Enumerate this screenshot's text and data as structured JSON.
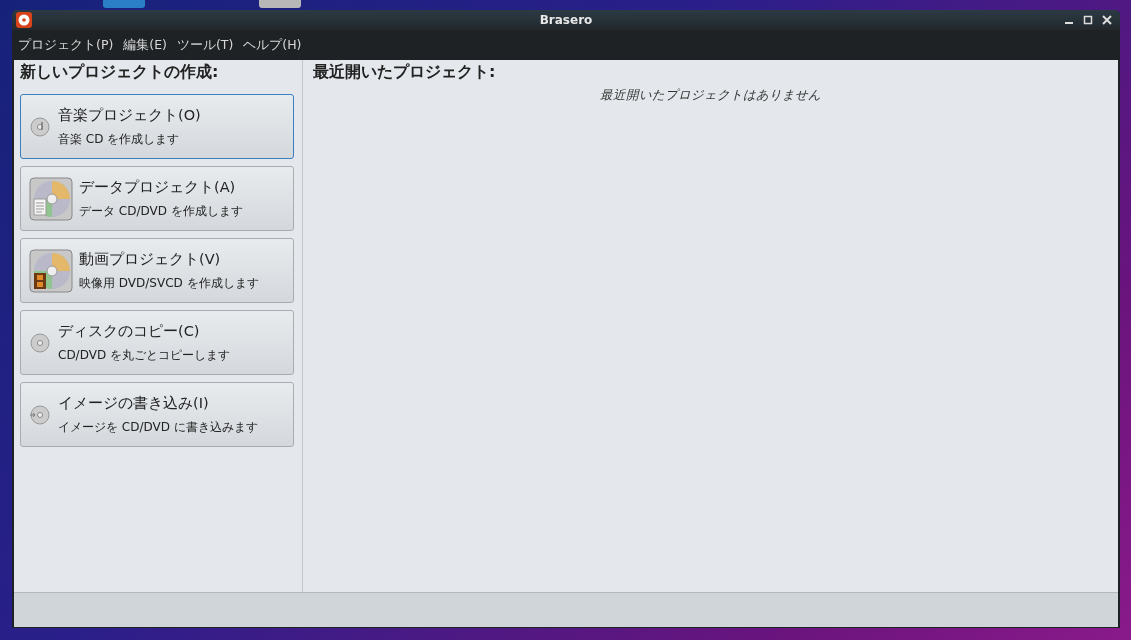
{
  "window": {
    "title": "Brasero"
  },
  "menu": [
    "プロジェクト(P)",
    "編集(E)",
    "ツール(T)",
    "ヘルプ(H)"
  ],
  "new_project": {
    "heading": "新しいプロジェクトの作成:",
    "buttons": [
      {
        "kind": "music",
        "label": "音楽プロジェクト(O)",
        "description": "音楽 CD を作成します",
        "focused": true
      },
      {
        "kind": "data",
        "label": "データプロジェクト(A)",
        "description": "データ CD/DVD を作成します",
        "focused": false
      },
      {
        "kind": "video",
        "label": "動画プロジェクト(V)",
        "description": "映像用 DVD/SVCD を作成します",
        "focused": false
      },
      {
        "kind": "copy",
        "label": "ディスクのコピー(C)",
        "description": "CD/DVD を丸ごとコピーします",
        "focused": false
      },
      {
        "kind": "burn",
        "label": "イメージの書き込み(I)",
        "description": "イメージを CD/DVD に書き込みます",
        "focused": false
      }
    ]
  },
  "recent": {
    "heading": "最近開いたプロジェクト:",
    "empty_message": "最近開いたプロジェクトはありません"
  }
}
